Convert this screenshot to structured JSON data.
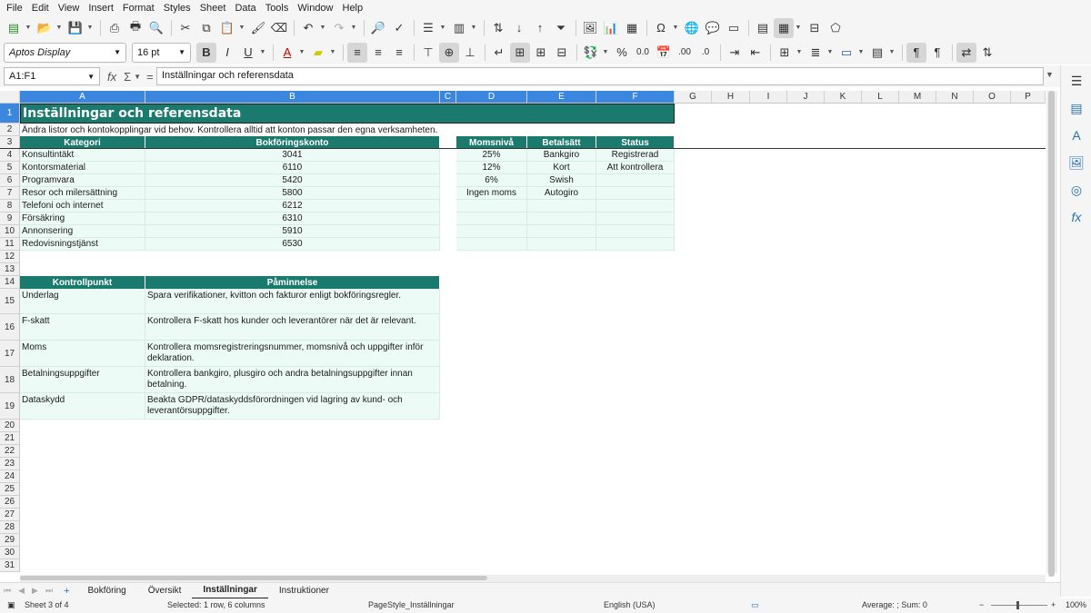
{
  "menu": [
    "File",
    "Edit",
    "View",
    "Insert",
    "Format",
    "Styles",
    "Sheet",
    "Data",
    "Tools",
    "Window",
    "Help"
  ],
  "toolbar": {
    "font_name": "Aptos Display",
    "font_size": "16 pt"
  },
  "formula_bar": {
    "name_box": "A1:F1",
    "content": "Inställningar och referensdata"
  },
  "columns": [
    "A",
    "B",
    "C",
    "D",
    "E",
    "F",
    "G",
    "H",
    "I",
    "J",
    "K",
    "L",
    "M",
    "N",
    "O",
    "P"
  ],
  "rows": [
    "1",
    "2",
    "3",
    "4",
    "5",
    "6",
    "7",
    "8",
    "9",
    "10",
    "11",
    "12",
    "13",
    "14",
    "15",
    "16",
    "17",
    "18",
    "19",
    "20",
    "21",
    "22",
    "23",
    "24",
    "25",
    "26",
    "27",
    "28",
    "29",
    "30",
    "31"
  ],
  "sheet": {
    "title": "Inställningar och referensdata",
    "subtitle": "Ändra listor och kontokopplingar vid behov. Kontrollera alltid att konton passar den egna verksamheten.",
    "account_headers": [
      "Kategori",
      "Bokföringskonto"
    ],
    "accounts": [
      {
        "kategori": "Konsultintäkt",
        "konto": "3041"
      },
      {
        "kategori": "Kontorsmaterial",
        "konto": "6110"
      },
      {
        "kategori": "Programvara",
        "konto": "5420"
      },
      {
        "kategori": "Resor och milersättning",
        "konto": "5800"
      },
      {
        "kategori": "Telefoni och internet",
        "konto": "6212"
      },
      {
        "kategori": "Försäkring",
        "konto": "6310"
      },
      {
        "kategori": "Annonsering",
        "konto": "5910"
      },
      {
        "kategori": "Redovisningstjänst",
        "konto": "6530"
      }
    ],
    "lists_headers": [
      "Momsnivå",
      "Betalsätt",
      "Status"
    ],
    "lists": [
      [
        "25%",
        "Bankgiro",
        "Registrerad"
      ],
      [
        "12%",
        "Kort",
        "Att kontrollera"
      ],
      [
        "6%",
        "Swish",
        ""
      ],
      [
        "Ingen moms",
        "Autogiro",
        ""
      ],
      [
        "",
        "",
        ""
      ],
      [
        "",
        "",
        ""
      ],
      [
        "",
        "",
        ""
      ],
      [
        "",
        "",
        ""
      ]
    ],
    "checks_headers": [
      "Kontrollpunkt",
      "Påminnelse"
    ],
    "checks": [
      {
        "punkt": "Underlag",
        "text": "Spara verifikationer, kvitton och fakturor enligt bokföringsregler."
      },
      {
        "punkt": "F-skatt",
        "text": "Kontrollera F-skatt hos kunder och leverantörer när det är relevant."
      },
      {
        "punkt": "Moms",
        "text": "Kontrollera momsregistreringsnummer, momsnivå och uppgifter inför deklaration."
      },
      {
        "punkt": "Betalningsuppgifter",
        "text": "Kontrollera bankgiro, plusgiro och andra betalningsuppgifter innan betalning."
      },
      {
        "punkt": "Dataskydd",
        "text": "Beakta GDPR/dataskyddsförordningen vid lagring av kund- och leverantörsuppgifter."
      }
    ]
  },
  "tabs": [
    "Bokföring",
    "Översikt",
    "Inställningar",
    "Instruktioner"
  ],
  "active_tab": "Inställningar",
  "status": {
    "sheet": "Sheet 3 of 4",
    "selection": "Selected: 1 row, 6 columns",
    "page_style": "PageStyle_Inställningar",
    "language": "English (USA)",
    "sum": "Average: ; Sum: 0",
    "zoom": "100%"
  },
  "colors": {
    "header": "#1a7a6e",
    "data": "#edfbf7",
    "selection": "#3b86df"
  }
}
